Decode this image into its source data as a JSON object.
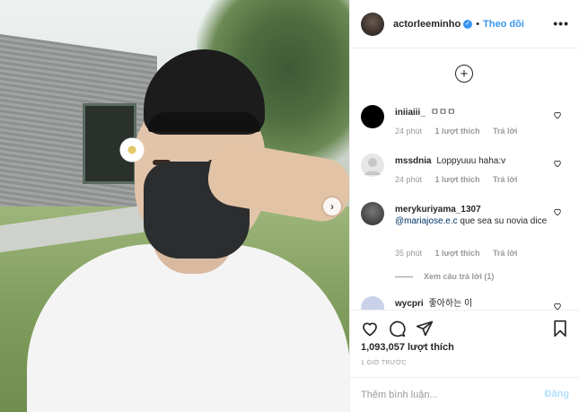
{
  "post": {
    "photo_alt": "",
    "next_icon": "chevron-right-icon"
  },
  "header": {
    "username": "actorleeminho",
    "verified_glyph": "✓",
    "separator": "•",
    "follow_label": "Theo dõi",
    "more_glyph": "•••"
  },
  "comments": {
    "load_more_glyph": "+",
    "items": [
      {
        "user": "iniiaiii_",
        "text": "ㅁㅁㅁ",
        "mention": "",
        "time": "24 phút",
        "likes": "1 lượt thích",
        "reply": "Trả lời",
        "avatar_color": "#000000"
      },
      {
        "user": "mssdnia",
        "text": "Loppyuuu haha:v",
        "mention": "",
        "time": "24 phút",
        "likes": "1 lượt thích",
        "reply": "Trả lời",
        "avatar_color": "#e0e0e0"
      },
      {
        "user": "merykuriyama_1307",
        "text": "que sea su novia dice",
        "mention": "@mariajose.e.c",
        "time": "35 phút",
        "likes": "1 lượt thích",
        "reply": "Trả lời",
        "avatar_color": "#4a4a4a"
      },
      {
        "user": "wycpri",
        "text": "좋아하는 이",
        "mention": "",
        "avatar_color": "#c9d2e8"
      }
    ],
    "view_replies": "Xem câu trả lời (1)"
  },
  "actions": {
    "like_icon": "heart-icon",
    "comment_icon": "comment-icon",
    "share_icon": "share-icon",
    "save_icon": "bookmark-icon",
    "likes_count": "1,093,057 lượt thích",
    "timestamp": "1 GIỜ TRƯỚC"
  },
  "add_comment": {
    "placeholder": "Thêm bình luận...",
    "post_label": "Đăng"
  }
}
